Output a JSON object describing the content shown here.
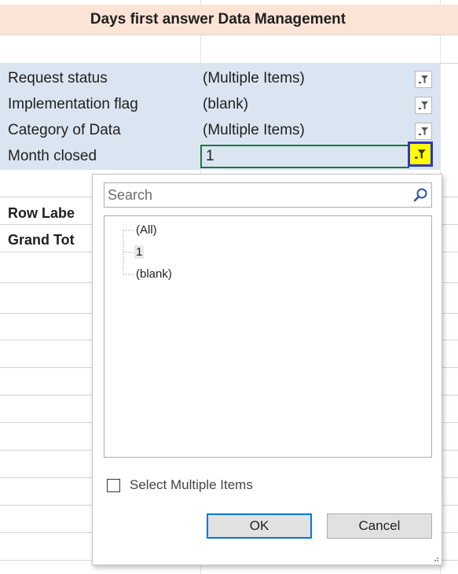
{
  "title": "Days first answer Data Management",
  "filters": [
    {
      "label": "Request status",
      "value": "(Multiple Items)"
    },
    {
      "label": "Implementation flag",
      "value": "(blank)"
    },
    {
      "label": "Category of Data",
      "value": "(Multiple Items)"
    },
    {
      "label": "Month closed",
      "value": "1"
    }
  ],
  "pivot": {
    "row_labels": "Row Labe",
    "grand_total": "Grand Tot"
  },
  "dropdown": {
    "search_placeholder": "Search",
    "items": [
      {
        "label": "(All)",
        "selected": false
      },
      {
        "label": "1",
        "selected": true
      },
      {
        "label": "(blank)",
        "selected": false
      }
    ],
    "select_multiple_label": "Select Multiple Items",
    "select_multiple_checked": false,
    "ok_label": "OK",
    "cancel_label": "Cancel"
  },
  "colors": {
    "title_band": "#fbe4d5",
    "filter_band": "#dbe5f1",
    "active_cell_border": "#217346",
    "highlight_button": "#ffff00",
    "highlight_border": "#3034c4",
    "ok_border": "#0078d7"
  }
}
